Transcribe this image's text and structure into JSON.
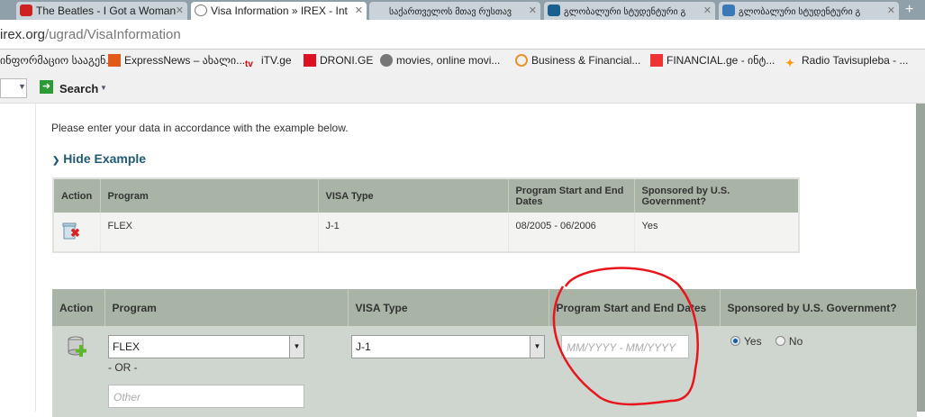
{
  "browser": {
    "tabs": [
      {
        "label": "The Beatles - I Got a Woman",
        "color": "#cc2222"
      },
      {
        "label": "Visa Information » IREX - Int",
        "color": "#888888"
      },
      {
        "label": "საქართველოს მთავ რუსთავ",
        "color": "#ffffff"
      },
      {
        "label": "გლობალური სტუდენტური გ",
        "color": "#1b5f8f"
      },
      {
        "label": "გლობალური სტუდენტური გ",
        "color": "#3a78b8"
      }
    ],
    "url_host": "irex.org",
    "url_path": "/ugrad/VisaInformation",
    "bookmarks": [
      "ინფორმაციო სააგენ...",
      "ExpressNews – ახალი...",
      "iTV.ge",
      "DRONI.GE",
      "movies, online movi...",
      "Business & Financial...",
      "FINANCIAL.ge - ინტ...",
      "Radio Tavisupleba - ..."
    ],
    "search_label": "Search"
  },
  "page": {
    "intro": "Please enter your data in accordance with the example below.",
    "hide_example": "Hide Example",
    "example": {
      "headers": [
        "Action",
        "Program",
        "VISA Type",
        "Program Start and End Dates",
        "Sponsored by U.S. Government?"
      ],
      "row": {
        "program": "FLEX",
        "visa": "J-1",
        "dates": "08/2005 - 06/2006",
        "sponsored": "Yes"
      }
    },
    "form": {
      "headers": [
        "Action",
        "Program",
        "VISA Type",
        "Program Start and End Dates",
        "Sponsored by U.S. Government?"
      ],
      "program_value": "FLEX",
      "or_label": "- OR -",
      "other_placeholder": "Other",
      "visa_value": "J-1",
      "dates_placeholder": "MM/YYYY - MM/YYYY",
      "yes_label": "Yes",
      "no_label": "No",
      "selected": "Yes"
    },
    "annotation_color": "#e8161c"
  }
}
